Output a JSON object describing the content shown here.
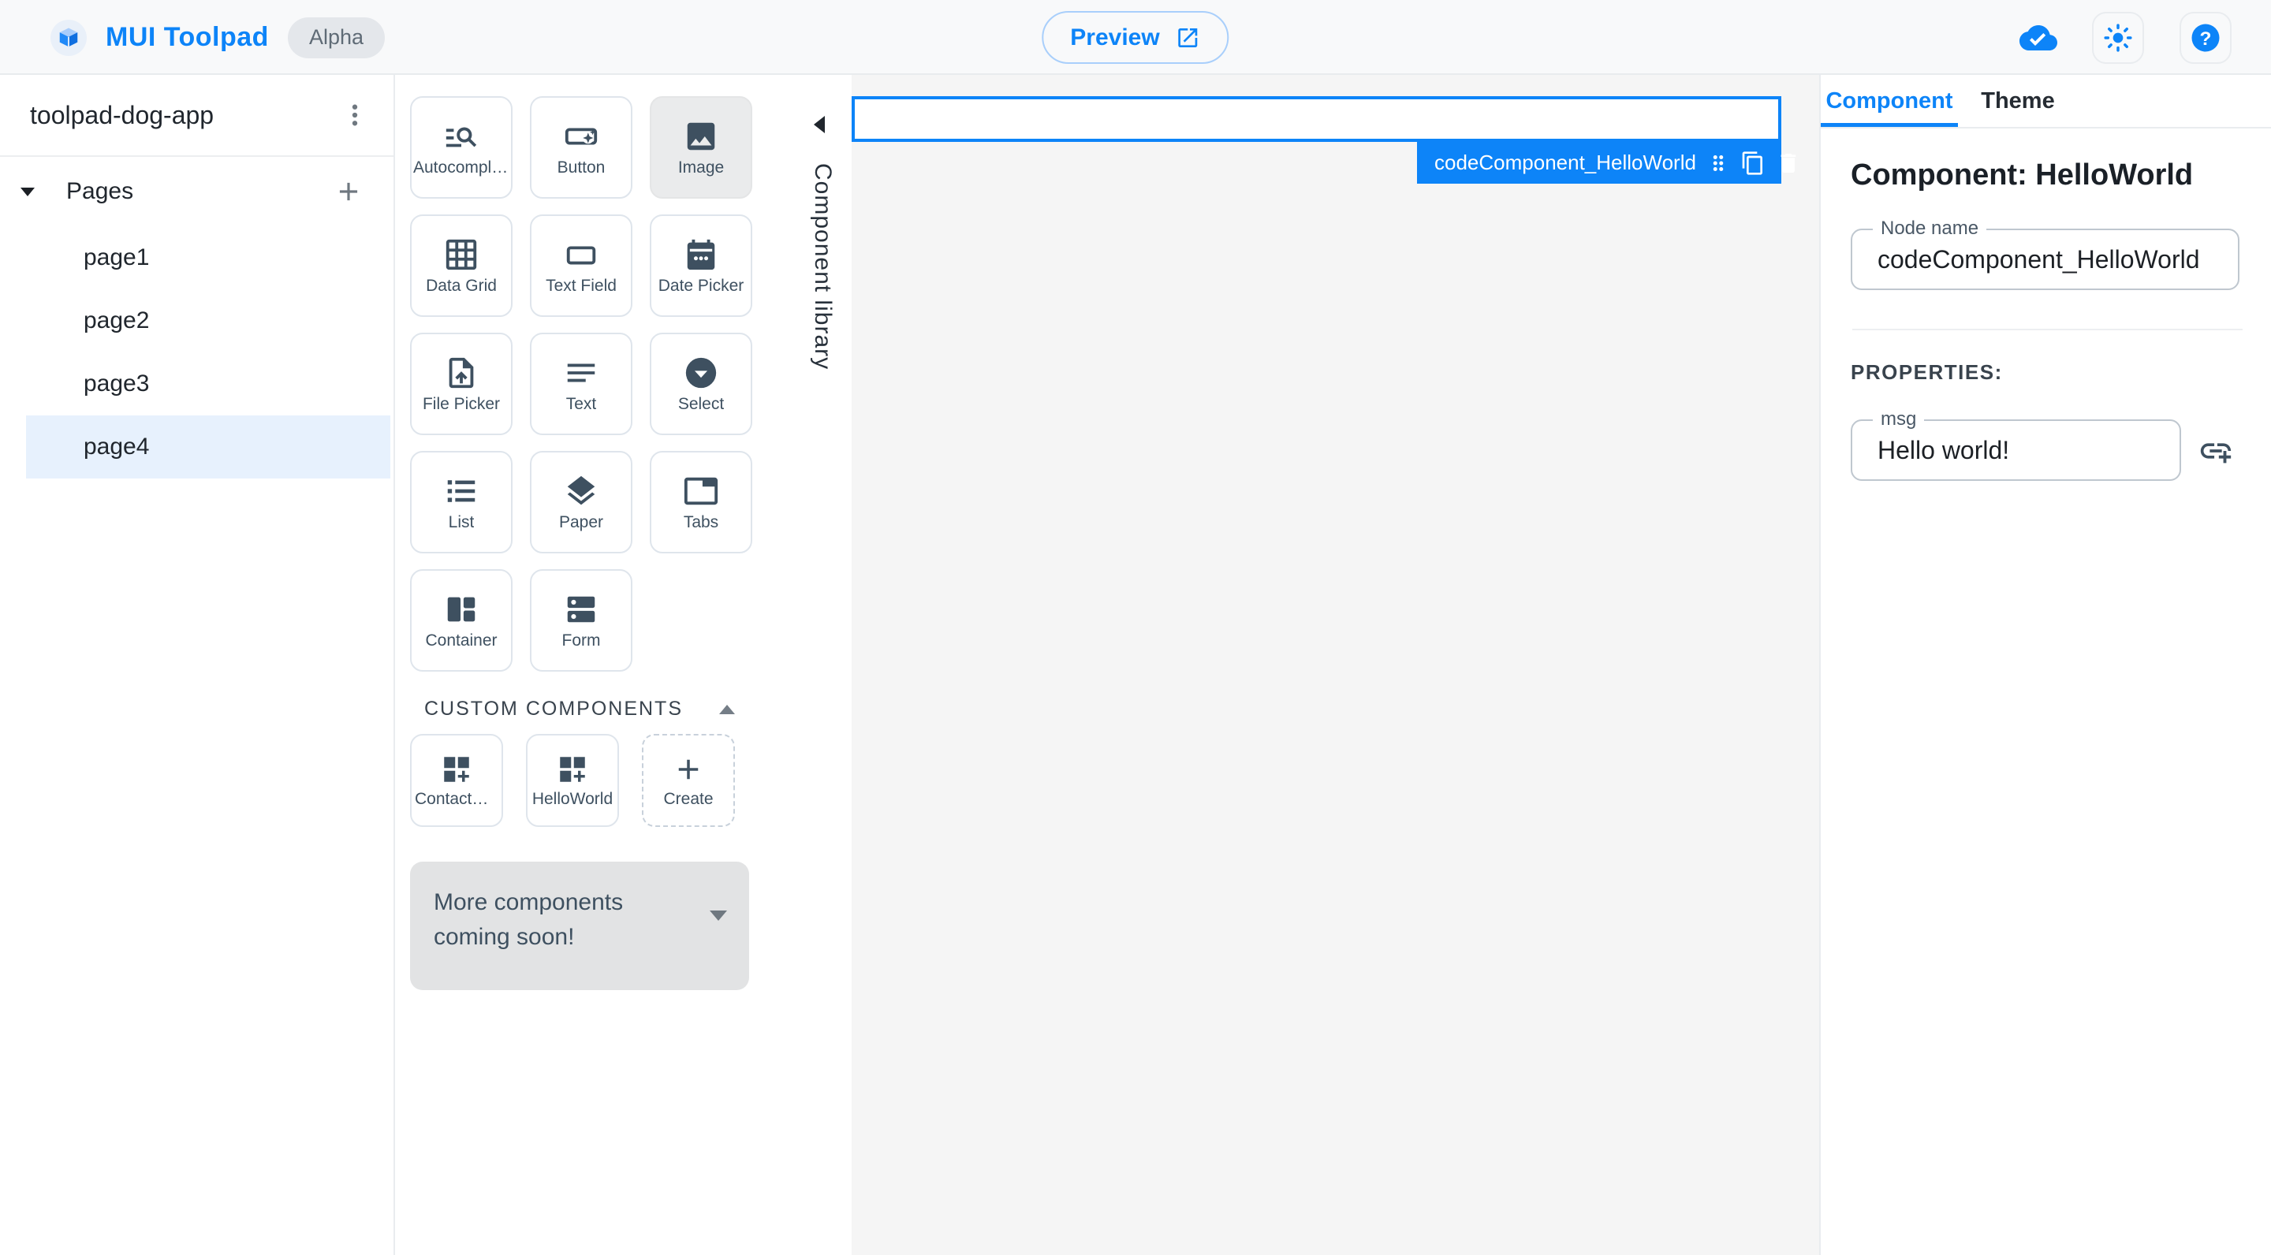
{
  "header": {
    "app_title": "MUI Toolpad",
    "badge": "Alpha",
    "preview_label": "Preview",
    "action_icons": [
      "cloud-done-icon",
      "light-mode-icon",
      "help-icon"
    ]
  },
  "sidebar": {
    "app_name": "toolpad-dog-app",
    "pages_label": "Pages",
    "pages": [
      "page1",
      "page2",
      "page3",
      "page4"
    ],
    "selected_page": "page4"
  },
  "library": {
    "title": "Component library",
    "components": [
      {
        "label": "Autocomplete",
        "icon": "autocomplete-icon"
      },
      {
        "label": "Button",
        "icon": "smart-button-icon"
      },
      {
        "label": "Image",
        "icon": "image-icon",
        "selected": true
      },
      {
        "label": "Data Grid",
        "icon": "grid-icon"
      },
      {
        "label": "Text Field",
        "icon": "text-field-icon"
      },
      {
        "label": "Date Picker",
        "icon": "calendar-icon"
      },
      {
        "label": "File Picker",
        "icon": "upload-file-icon"
      },
      {
        "label": "Text",
        "icon": "notes-icon"
      },
      {
        "label": "Select",
        "icon": "dropdown-circle-icon"
      },
      {
        "label": "List",
        "icon": "list-icon"
      },
      {
        "label": "Paper",
        "icon": "layers-icon"
      },
      {
        "label": "Tabs",
        "icon": "tab-icon"
      },
      {
        "label": "Container",
        "icon": "container-icon"
      },
      {
        "label": "Form",
        "icon": "form-icon"
      }
    ],
    "custom_section_label": "CUSTOM COMPONENTS",
    "custom_components": [
      {
        "label": "ContactSta…",
        "icon": "dashboard-customize-icon"
      },
      {
        "label": "HelloWorld",
        "icon": "dashboard-customize-icon"
      }
    ],
    "create_label": "Create",
    "coming_soon": "More components coming soon!"
  },
  "canvas": {
    "selected_node_label": "codeComponent_HelloWorld",
    "chip_icons": [
      "drag-indicator-icon",
      "copy-icon",
      "delete-icon"
    ]
  },
  "inspector": {
    "tabs": [
      {
        "label": "Component",
        "active": true
      },
      {
        "label": "Theme",
        "active": false
      }
    ],
    "heading": "Component: HelloWorld",
    "node_name_label": "Node name",
    "node_name_value": "codeComponent_HelloWorld",
    "properties_label": "PROPERTIES:",
    "msg_label": "msg",
    "msg_value": "Hello world!"
  },
  "colors": {
    "accent": "#0D84F8",
    "icon_slate": "#3E5060",
    "canvas_bg": "#F5F5F5",
    "selected_page_bg": "#E7F1FD",
    "text_dark": "#1C2025"
  }
}
